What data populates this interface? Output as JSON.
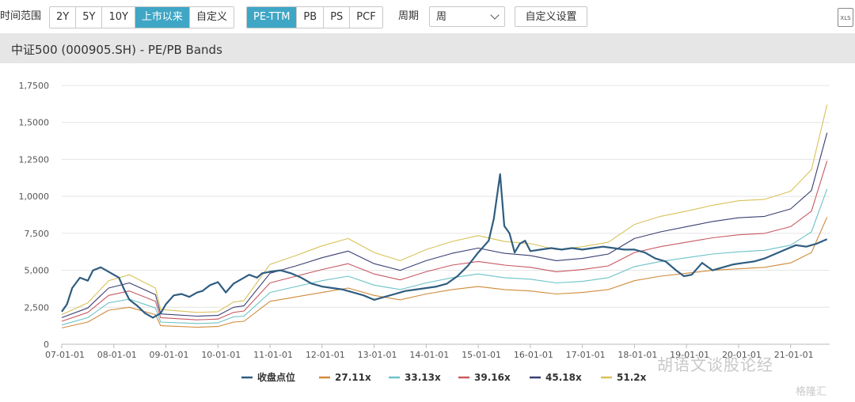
{
  "toolbar": {
    "range_label": "时间范围",
    "range_buttons": [
      "2Y",
      "5Y",
      "10Y",
      "上市以来",
      "自定义"
    ],
    "range_active": 3,
    "metric_buttons": [
      "PE-TTM",
      "PB",
      "PS",
      "PCF"
    ],
    "metric_active": 0,
    "period_label": "周期",
    "period_value": "周",
    "settings_label": "自定义设置",
    "export_label": "XLS"
  },
  "title": "中证500 (000905.SH) - PE/PB Bands",
  "watermark": "胡语文谈股论经",
  "watermark2": "格隆汇",
  "colors": {
    "price": "#2f5d80",
    "band1": "#d08a3a",
    "band2": "#6cc2c6",
    "band3": "#c75a63",
    "band4": "#3a3f73",
    "band5": "#d8c25a",
    "toolbar_active": "#3fa6c5"
  },
  "chart_data": {
    "type": "line",
    "title": "中证500 (000905.SH) - PE/PB Bands",
    "x_ticks": [
      "07-01-01",
      "08-01-01",
      "09-01-01",
      "10-01-01",
      "11-01-01",
      "12-01-01",
      "13-01-01",
      "14-01-01",
      "15-01-01",
      "16-01-01",
      "17-01-01",
      "18-01-01",
      "19-01-01",
      "20-01-01",
      "21-01-01"
    ],
    "x_range": [
      2007.0,
      2021.75
    ],
    "ylim": [
      0,
      17500
    ],
    "y_ticks": [
      0,
      2500,
      5000,
      7500,
      10000,
      12500,
      15000,
      17500
    ],
    "y_tick_labels": [
      "0",
      "2,500",
      "5,000",
      "7,500",
      "1,0000",
      "1,2500",
      "1,5000",
      "1,7500"
    ],
    "grid": true,
    "legend_position": "bottom",
    "series": [
      {
        "name": "收盘点位",
        "key": "price",
        "x": [
          2007.0,
          2007.1,
          2007.2,
          2007.35,
          2007.5,
          2007.6,
          2007.75,
          2007.9,
          2008.0,
          2008.1,
          2008.2,
          2008.3,
          2008.45,
          2008.6,
          2008.75,
          2008.9,
          2009.0,
          2009.15,
          2009.3,
          2009.45,
          2009.6,
          2009.7,
          2009.85,
          2010.0,
          2010.15,
          2010.3,
          2010.45,
          2010.6,
          2010.75,
          2010.85,
          2011.0,
          2011.2,
          2011.4,
          2011.6,
          2011.8,
          2012.0,
          2012.2,
          2012.4,
          2012.6,
          2012.8,
          2013.0,
          2013.2,
          2013.4,
          2013.6,
          2013.8,
          2014.0,
          2014.2,
          2014.4,
          2014.6,
          2014.8,
          2015.0,
          2015.2,
          2015.3,
          2015.42,
          2015.5,
          2015.6,
          2015.7,
          2015.8,
          2015.9,
          2016.0,
          2016.2,
          2016.4,
          2016.6,
          2016.8,
          2017.0,
          2017.2,
          2017.4,
          2017.6,
          2017.8,
          2018.0,
          2018.2,
          2018.4,
          2018.6,
          2018.8,
          2018.95,
          2019.1,
          2019.3,
          2019.5,
          2019.7,
          2019.9,
          2020.1,
          2020.3,
          2020.5,
          2020.7,
          2020.9,
          2021.1,
          2021.3,
          2021.5,
          2021.7
        ],
        "values": [
          2200,
          2700,
          3800,
          4500,
          4300,
          5000,
          5200,
          4900,
          4700,
          4500,
          3700,
          3000,
          2600,
          2100,
          1800,
          2100,
          2700,
          3300,
          3400,
          3200,
          3500,
          3600,
          4000,
          4200,
          3500,
          4100,
          4400,
          4700,
          4500,
          4800,
          4900,
          5000,
          4800,
          4500,
          4100,
          3900,
          3800,
          3700,
          3500,
          3300,
          3000,
          3200,
          3400,
          3600,
          3700,
          3800,
          3900,
          4100,
          4600,
          5300,
          6200,
          7000,
          8500,
          11500,
          8000,
          7500,
          6200,
          6800,
          7000,
          6300,
          6400,
          6500,
          6400,
          6500,
          6400,
          6500,
          6600,
          6500,
          6400,
          6400,
          6200,
          5800,
          5600,
          5000,
          4600,
          4700,
          5500,
          5000,
          5200,
          5400,
          5500,
          5600,
          5800,
          6100,
          6400,
          6700,
          6600,
          6800,
          7100
        ]
      },
      {
        "name": "27.11x",
        "key": "band1",
        "x": [
          2007.0,
          2007.5,
          2007.9,
          2008.3,
          2008.8,
          2008.9,
          2009.6,
          2010.0,
          2010.3,
          2010.5,
          2011.0,
          2011.5,
          2012.0,
          2012.5,
          2013.0,
          2013.5,
          2014.0,
          2014.5,
          2015.0,
          2015.5,
          2016.0,
          2016.5,
          2017.0,
          2017.5,
          2018.0,
          2018.5,
          2019.0,
          2019.5,
          2020.0,
          2020.5,
          2021.0,
          2021.4,
          2021.7
        ],
        "values": [
          1100,
          1500,
          2300,
          2500,
          2000,
          1250,
          1150,
          1200,
          1500,
          1550,
          2900,
          3200,
          3500,
          3800,
          3300,
          3000,
          3400,
          3700,
          3900,
          3700,
          3600,
          3400,
          3500,
          3700,
          4300,
          4600,
          4800,
          5000,
          5100,
          5200,
          5500,
          6200,
          8600
        ]
      },
      {
        "name": "33.13x",
        "key": "band2",
        "x": [
          2007.0,
          2007.5,
          2007.9,
          2008.3,
          2008.8,
          2008.9,
          2009.6,
          2010.0,
          2010.3,
          2010.5,
          2011.0,
          2011.5,
          2012.0,
          2012.5,
          2013.0,
          2013.5,
          2014.0,
          2014.5,
          2015.0,
          2015.5,
          2016.0,
          2016.5,
          2017.0,
          2017.5,
          2018.0,
          2018.5,
          2019.0,
          2019.5,
          2020.0,
          2020.5,
          2021.0,
          2021.4,
          2021.7
        ],
        "values": [
          1300,
          1800,
          2800,
          3050,
          2450,
          1500,
          1400,
          1450,
          1850,
          1900,
          3500,
          3900,
          4300,
          4600,
          4000,
          3700,
          4150,
          4500,
          4750,
          4500,
          4400,
          4150,
          4250,
          4500,
          5250,
          5600,
          5850,
          6100,
          6250,
          6350,
          6700,
          7600,
          10500
        ]
      },
      {
        "name": "39.16x",
        "key": "band3",
        "x": [
          2007.0,
          2007.5,
          2007.9,
          2008.3,
          2008.8,
          2008.9,
          2009.6,
          2010.0,
          2010.3,
          2010.5,
          2011.0,
          2011.5,
          2012.0,
          2012.5,
          2013.0,
          2013.5,
          2014.0,
          2014.5,
          2015.0,
          2015.5,
          2016.0,
          2016.5,
          2017.0,
          2017.5,
          2018.0,
          2018.5,
          2019.0,
          2019.5,
          2020.0,
          2020.5,
          2021.0,
          2021.4,
          2021.7
        ],
        "values": [
          1550,
          2150,
          3300,
          3600,
          2900,
          1800,
          1650,
          1700,
          2150,
          2250,
          4150,
          4600,
          5050,
          5450,
          4750,
          4350,
          4900,
          5350,
          5600,
          5350,
          5200,
          4900,
          5050,
          5300,
          6200,
          6600,
          6900,
          7200,
          7400,
          7500,
          7950,
          9000,
          12400
        ]
      },
      {
        "name": "45.18x",
        "key": "band4",
        "x": [
          2007.0,
          2007.5,
          2007.9,
          2008.3,
          2008.8,
          2008.9,
          2009.6,
          2010.0,
          2010.3,
          2010.5,
          2011.0,
          2011.5,
          2012.0,
          2012.5,
          2013.0,
          2013.5,
          2014.0,
          2014.5,
          2015.0,
          2015.5,
          2016.0,
          2016.5,
          2017.0,
          2017.5,
          2018.0,
          2018.5,
          2019.0,
          2019.5,
          2020.0,
          2020.5,
          2021.0,
          2021.4,
          2021.7
        ],
        "values": [
          1800,
          2450,
          3800,
          4150,
          3350,
          2050,
          1900,
          1950,
          2500,
          2600,
          4800,
          5300,
          5850,
          6300,
          5450,
          5000,
          5650,
          6150,
          6500,
          6150,
          6000,
          5650,
          5800,
          6100,
          7150,
          7600,
          7950,
          8300,
          8550,
          8650,
          9150,
          10400,
          14300
        ]
      },
      {
        "name": "51.2x",
        "key": "band5",
        "x": [
          2007.0,
          2007.5,
          2007.9,
          2008.3,
          2008.8,
          2008.9,
          2009.6,
          2010.0,
          2010.3,
          2010.5,
          2011.0,
          2011.5,
          2012.0,
          2012.5,
          2013.0,
          2013.5,
          2014.0,
          2014.5,
          2015.0,
          2015.5,
          2016.0,
          2016.5,
          2017.0,
          2017.5,
          2018.0,
          2018.5,
          2019.0,
          2019.5,
          2020.0,
          2020.5,
          2021.0,
          2021.4,
          2021.7
        ],
        "values": [
          2000,
          2800,
          4300,
          4700,
          3800,
          2350,
          2150,
          2200,
          2850,
          2950,
          5400,
          6000,
          6650,
          7150,
          6200,
          5650,
          6400,
          6950,
          7350,
          6950,
          6800,
          6400,
          6600,
          6900,
          8100,
          8650,
          9000,
          9400,
          9700,
          9800,
          10350,
          11800,
          16200
        ]
      }
    ]
  }
}
